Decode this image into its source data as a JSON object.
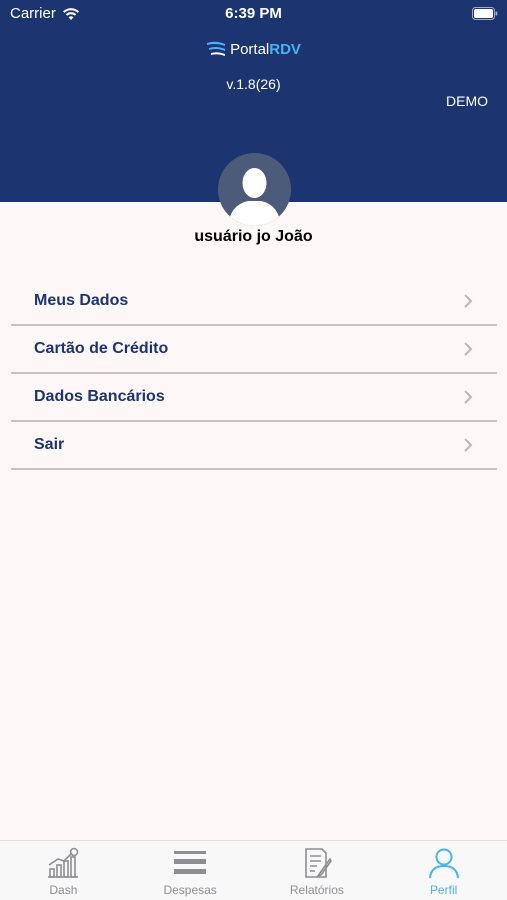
{
  "status_bar": {
    "carrier": "Carrier",
    "time": "6:39 PM"
  },
  "header": {
    "logo_portal": "Portal",
    "logo_rdv": "RDV",
    "version": "v.1.8(26)",
    "environment": "DEMO",
    "background_color": "#1c3470"
  },
  "profile": {
    "name": "usuário  jo João"
  },
  "menu": {
    "items": [
      {
        "label": "Meus Dados"
      },
      {
        "label": "Cartão de Crédito"
      },
      {
        "label": "Dados Bancários"
      },
      {
        "label": "Sair"
      }
    ]
  },
  "tabbar": {
    "active_color": "#4ab2f0",
    "tabs": [
      {
        "label": "Dash",
        "icon": "chart-growth-icon"
      },
      {
        "label": "Despesas",
        "icon": "list-icon"
      },
      {
        "label": "Relatórios",
        "icon": "report-icon"
      },
      {
        "label": "Perfil",
        "icon": "user-icon",
        "active": true
      }
    ]
  }
}
